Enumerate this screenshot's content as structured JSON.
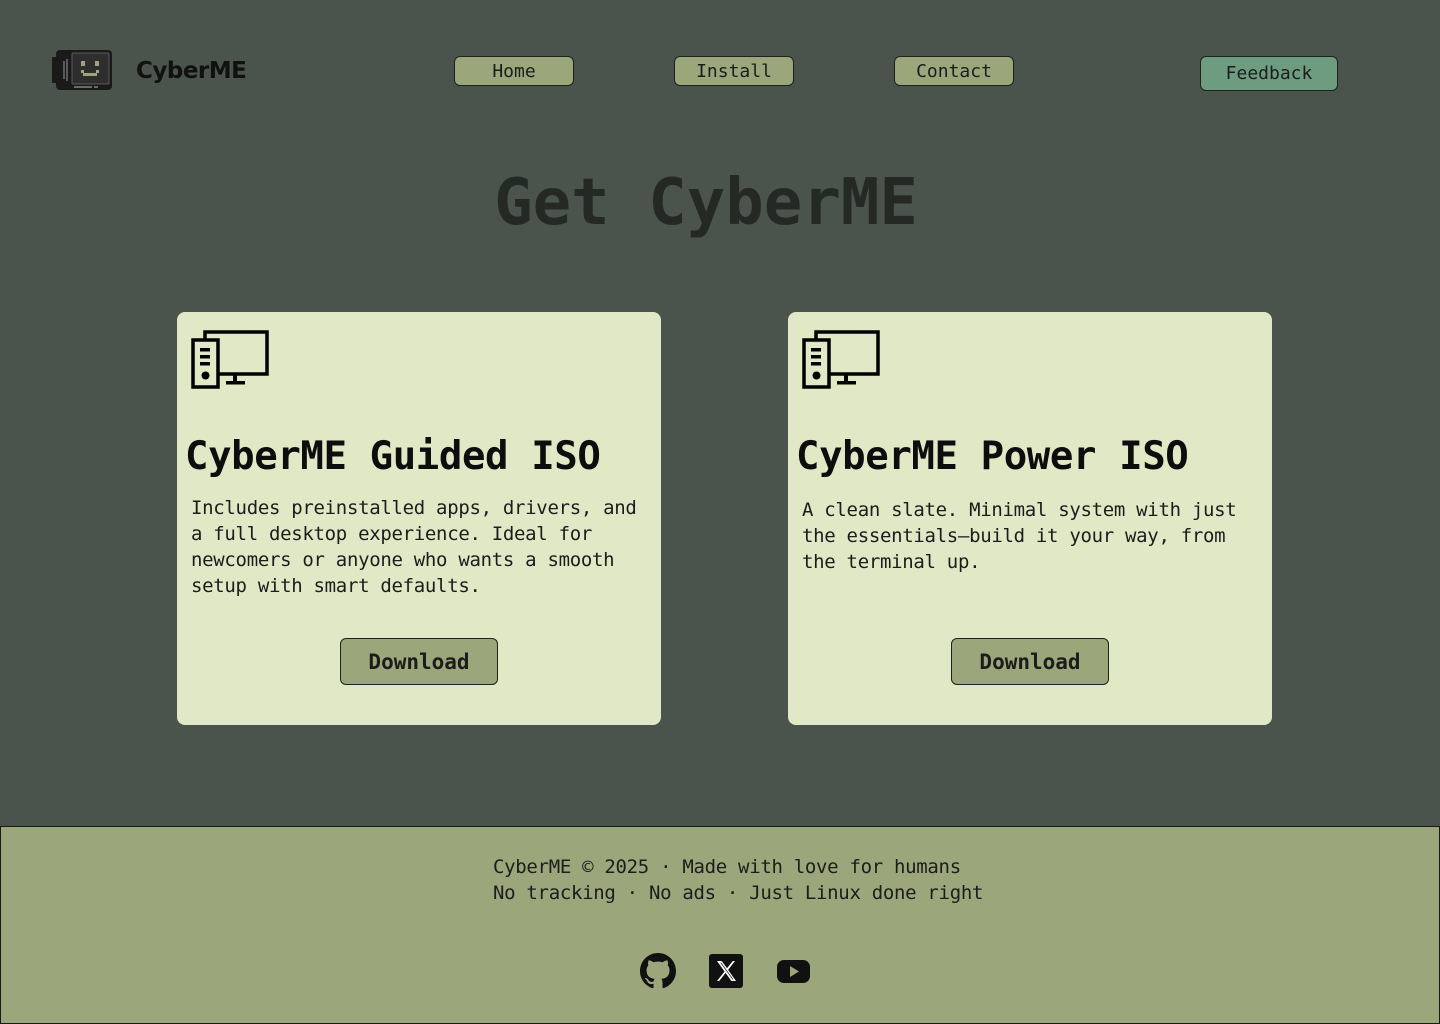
{
  "header": {
    "brand": "CyberME",
    "logo_icon": "smiley-computer-logo-icon",
    "nav": [
      {
        "label": "Home"
      },
      {
        "label": "Install"
      },
      {
        "label": "Contact"
      }
    ],
    "feedback_label": "Feedback"
  },
  "main": {
    "title": "Get CyberME",
    "cards": [
      {
        "icon": "desktop-computer-icon",
        "title": "CyberME Guided ISO",
        "description": "Includes preinstalled apps, drivers, and a full desktop experience. Ideal for newcomers or anyone who wants a smooth setup with smart defaults.",
        "button": "Download"
      },
      {
        "icon": "desktop-computer-icon",
        "title": "CyberME Power ISO",
        "description": "A clean slate. Minimal system with just the essentials—build it your way, from the terminal up.",
        "button": "Download"
      }
    ]
  },
  "footer": {
    "line1": "CyberME © 2025 · Made with love for humans",
    "line2": "No tracking · No ads · Just Linux done right",
    "social": [
      {
        "icon": "github-icon"
      },
      {
        "icon": "x-twitter-icon"
      },
      {
        "icon": "youtube-icon"
      }
    ]
  },
  "colors": {
    "background": "#4a544c",
    "nav_button": "#9ba67b",
    "feedback_button": "#6e9c80",
    "card": "#e1e8c6",
    "footer": "#9ba67b"
  }
}
